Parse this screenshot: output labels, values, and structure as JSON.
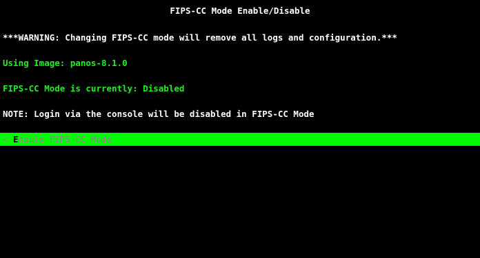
{
  "screen": {
    "title": "FIPS-CC Mode Enable/Disable",
    "warning": "***WARNING: Changing FIPS-CC mode will remove all logs and configuration.***",
    "image_line": "Using Image: panos-8.1.0",
    "status_line": "FIPS-CC Mode is currently: Disabled",
    "note": "NOTE: Login via the console will be disabled in FIPS-CC Mode"
  },
  "menu": {
    "items": [
      {
        "prefix": "< ",
        "hotkey": "E",
        "rest": "nable FIPS-CC Mode"
      }
    ]
  },
  "colors": {
    "background": "#000000",
    "text": "#ffffff",
    "info_text": "#22ee22",
    "highlight_bar": "#00ff00",
    "menu_text": "#888888"
  }
}
